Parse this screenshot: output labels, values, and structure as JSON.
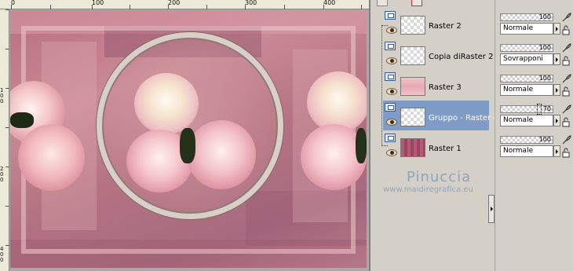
{
  "ruler": {
    "h_labels": [
      "0",
      "100",
      "200",
      "300",
      "400"
    ],
    "v_labels": [
      "1",
      "0",
      "0",
      "2",
      "0",
      "0",
      "4",
      "0",
      "0",
      "0"
    ]
  },
  "layers": [
    {
      "name": "Raster 2",
      "selected": false,
      "thumb": "transparent"
    },
    {
      "name": "Copia diRaster 2",
      "selected": false,
      "thumb": "transparent"
    },
    {
      "name": "Raster 3",
      "selected": false,
      "thumb": "pink"
    },
    {
      "name": "Gruppo - Raster 4",
      "selected": true,
      "thumb": "transparent"
    },
    {
      "name": "Raster 1",
      "selected": false,
      "thumb": "rosepattern"
    }
  ],
  "props": [
    {
      "opacity": "100",
      "blend": "Normale"
    },
    {
      "opacity": "100",
      "blend": "Sovrapponi"
    },
    {
      "opacity": "100",
      "blend": "Normale"
    },
    {
      "opacity": "70",
      "blend": "Normale"
    },
    {
      "opacity": "100",
      "blend": "Normale"
    }
  ],
  "watermark": {
    "name": "Pinuccia",
    "url": "www.maidiregrafica.eu"
  },
  "colors": {
    "selected_layer": "#7e9cc7",
    "watermark": "#8fa5b9",
    "panel_bg": "#d4d0c8"
  }
}
